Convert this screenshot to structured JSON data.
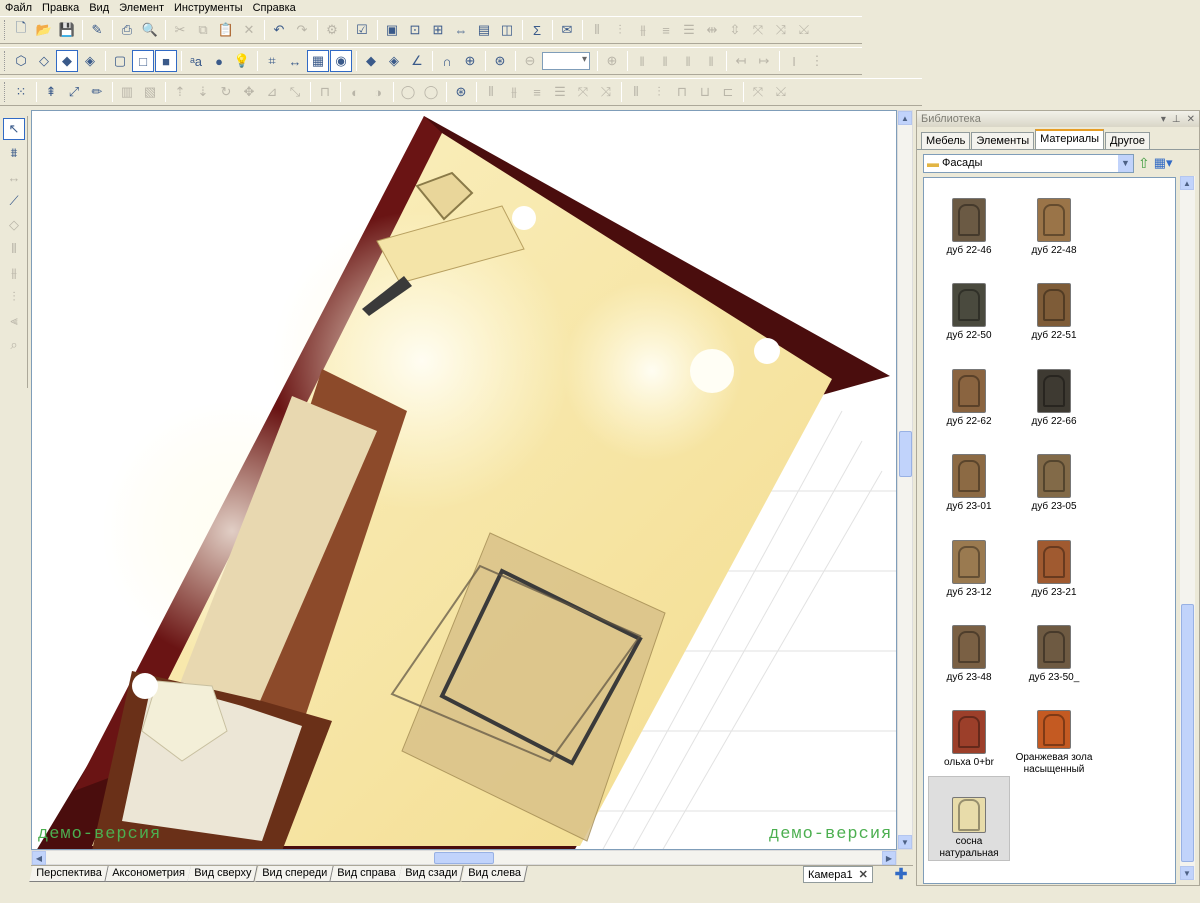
{
  "menu": [
    "Файл",
    "Правка",
    "Вид",
    "Элемент",
    "Инструменты",
    "Справка"
  ],
  "toolbar1": {
    "groups": [
      [
        "new-file-icon",
        "open-file-icon",
        "save-icon"
      ],
      [
        "edit-properties-icon"
      ],
      [
        "print-icon",
        "print-preview-icon"
      ],
      [
        "cut-icon",
        "copy-icon",
        "paste-icon",
        "delete-icon"
      ],
      [
        "undo-icon",
        "redo-icon"
      ],
      [
        "settings-icon"
      ],
      [
        "checklist-icon"
      ],
      [
        "view-frame-icon",
        "zoom-frame-icon",
        "properties-frame-icon",
        "resize-frame-icon",
        "photo-frame-icon",
        "camera-frame-icon"
      ],
      [
        "sum-icon"
      ],
      [
        "mail-icon"
      ],
      [
        "align-left-icon",
        "align-center-icon",
        "align-right-icon",
        "distribute-icon",
        "distribute-v-icon",
        "space-icon",
        "space-v-icon",
        "snap-icon",
        "snap-b-icon",
        "snap-c-icon"
      ]
    ],
    "glyphs": {
      "new-file-icon": "🗋",
      "open-file-icon": "📂",
      "save-icon": "💾",
      "edit-properties-icon": "✎",
      "print-icon": "⎙",
      "print-preview-icon": "🔍",
      "cut-icon": "✂",
      "copy-icon": "⧉",
      "paste-icon": "📋",
      "delete-icon": "✕",
      "undo-icon": "↶",
      "redo-icon": "↷",
      "settings-icon": "⚙",
      "checklist-icon": "☑",
      "view-frame-icon": "▣",
      "zoom-frame-icon": "⊡",
      "properties-frame-icon": "⊞",
      "resize-frame-icon": "⇔",
      "photo-frame-icon": "▤",
      "camera-frame-icon": "◫",
      "sum-icon": "Σ",
      "mail-icon": "✉",
      "align-left-icon": "⫴",
      "align-center-icon": "⫶",
      "align-right-icon": "⫵",
      "distribute-icon": "≡",
      "distribute-v-icon": "☰",
      "space-icon": "⇹",
      "space-v-icon": "⇳",
      "snap-icon": "⤧",
      "snap-b-icon": "⤨",
      "snap-c-icon": "⤩"
    },
    "disabled": [
      "cut-icon",
      "copy-icon",
      "paste-icon",
      "delete-icon",
      "redo-icon",
      "settings-icon",
      "align-left-icon",
      "align-center-icon",
      "align-right-icon",
      "distribute-icon",
      "distribute-v-icon",
      "space-icon",
      "space-v-icon",
      "snap-icon",
      "snap-b-icon",
      "snap-c-icon"
    ]
  },
  "toolbar2": {
    "groups": [
      [
        "box-wire-icon",
        "box-hidden-icon",
        "box-shaded-icon",
        "box-dark-icon"
      ],
      [
        "cube-wire-icon",
        "cube-outline-icon",
        "cube-solid-icon"
      ],
      [
        "text-style-icon",
        "material-icon",
        "light-icon"
      ],
      [
        "measure-icon",
        "dimension-icon",
        "grid-icon",
        "eye-icon"
      ],
      [
        "point-snap-icon",
        "node-snap-icon",
        "angle-snap-icon"
      ],
      [
        "magnet-icon",
        "target-icon"
      ],
      [
        "lifebuoy-icon"
      ],
      [
        "zoom-out-icon"
      ],
      [
        "zoom-in-icon"
      ],
      [
        "hd-a-icon",
        "hd-b-icon",
        "hd-c-icon",
        "hd-d-icon"
      ],
      [
        "ruler-h-icon",
        "ruler-h2-icon"
      ],
      [
        "ruler-v-icon",
        "ruler-v2-icon"
      ]
    ],
    "glyphs": {
      "box-wire-icon": "⬡",
      "box-hidden-icon": "◇",
      "box-shaded-icon": "◆",
      "box-dark-icon": "◈",
      "cube-wire-icon": "▢",
      "cube-outline-icon": "□",
      "cube-solid-icon": "■",
      "text-style-icon": "ᵃa",
      "material-icon": "●",
      "light-icon": "💡",
      "measure-icon": "⌗",
      "dimension-icon": "↔",
      "grid-icon": "▦",
      "eye-icon": "◉",
      "point-snap-icon": "◆",
      "node-snap-icon": "◈",
      "angle-snap-icon": "∠",
      "magnet-icon": "∩",
      "target-icon": "⊕",
      "lifebuoy-icon": "⊛",
      "zoom-out-icon": "⊖",
      "zoom-in-icon": "⊕",
      "hd-a-icon": "‖",
      "hd-b-icon": "‖",
      "hd-c-icon": "‖",
      "hd-d-icon": "‖",
      "ruler-h-icon": "↤",
      "ruler-h2-icon": "↦",
      "ruler-v-icon": "I",
      "ruler-v2-icon": "⋮"
    },
    "pressed": [
      "box-shaded-icon",
      "cube-outline-icon",
      "cube-solid-icon",
      "grid-icon",
      "eye-icon"
    ],
    "disabled": [
      "zoom-out-icon",
      "zoom-in-icon",
      "hd-a-icon",
      "hd-b-icon",
      "hd-c-icon",
      "hd-d-icon",
      "ruler-h-icon",
      "ruler-h2-icon",
      "ruler-v-icon",
      "ruler-v2-icon"
    ],
    "zoom_value": ""
  },
  "toolbar3": {
    "groups": [
      [
        "select-grid-icon"
      ],
      [
        "move-up-icon",
        "pointer-move-icon",
        "pencil-icon"
      ],
      [
        "t3a-icon",
        "t3b-icon"
      ],
      [
        "t3c-icon",
        "t3d-icon",
        "t3e-icon",
        "t3f-icon",
        "t3g-icon",
        "t3h-icon"
      ],
      [
        "t3i-icon"
      ],
      [
        "t3j-icon",
        "t3k-icon"
      ],
      [
        "t3l-icon",
        "t3m-icon"
      ],
      [
        "stop-icon"
      ],
      [
        "t3n-icon",
        "t3o-icon",
        "t3p-icon",
        "t3q-icon",
        "t3r-icon",
        "t3s-icon"
      ],
      [
        "t3t-icon",
        "t3u-icon",
        "t3v-icon",
        "t3w-icon",
        "t3x-icon"
      ],
      [
        "t3y-icon",
        "t3z-icon"
      ]
    ],
    "glyphs": {
      "select-grid-icon": "⁙",
      "move-up-icon": "⇞",
      "pointer-move-icon": "⤢",
      "pencil-icon": "✏",
      "t3a-icon": "▥",
      "t3b-icon": "▧",
      "t3c-icon": "⇡",
      "t3d-icon": "⇣",
      "t3e-icon": "↻",
      "t3f-icon": "✥",
      "t3g-icon": "⊿",
      "t3h-icon": "⤡",
      "t3i-icon": "⊓",
      "t3j-icon": "◐",
      "t3k-icon": "◑",
      "t3l-icon": "◯",
      "t3m-icon": "◯",
      "stop-icon": "⊛",
      "t3n-icon": "⫴",
      "t3o-icon": "⫵",
      "t3p-icon": "≡",
      "t3q-icon": "☰",
      "t3r-icon": "⤧",
      "t3s-icon": "⤨",
      "t3t-icon": "⫴",
      "t3u-icon": "⫶",
      "t3v-icon": "⊓",
      "t3w-icon": "⊔",
      "t3x-icon": "⊏",
      "t3y-icon": "⤧",
      "t3z-icon": "⤩"
    },
    "enabled": [
      "select-grid-icon",
      "move-up-icon",
      "pointer-move-icon",
      "pencil-icon",
      "stop-icon"
    ]
  },
  "left_tools": [
    {
      "name": "select-arrow-icon",
      "glyph": "↖",
      "pressed": true,
      "enabled": true
    },
    {
      "name": "wall-tool-icon",
      "glyph": "⩩",
      "enabled": true
    },
    {
      "name": "dimension-tool-icon",
      "glyph": "↔",
      "enabled": false
    },
    {
      "name": "eyedropper-icon",
      "glyph": "⟋",
      "enabled": true
    },
    {
      "name": "erase-tool-icon",
      "glyph": "◇",
      "enabled": false
    },
    {
      "name": "align-tool-a-icon",
      "glyph": "⫴",
      "enabled": false
    },
    {
      "name": "align-tool-b-icon",
      "glyph": "⫵",
      "enabled": false
    },
    {
      "name": "align-tool-c-icon",
      "glyph": "⫶",
      "enabled": false
    },
    {
      "name": "align-tool-d-icon",
      "glyph": "⫷",
      "enabled": false
    },
    {
      "name": "zoom-tool-icon",
      "glyph": "⌕",
      "enabled": false
    }
  ],
  "viewport": {
    "watermark_left": "демо-версия",
    "watermark_right": "демо-версия"
  },
  "view_tabs": [
    "Перспектива",
    "Аксонометрия",
    "Вид сверху",
    "Вид спереди",
    "Вид справа",
    "Вид сзади",
    "Вид слева"
  ],
  "camera_tab": "Камера1",
  "library": {
    "title": "Библиотека",
    "tabs": [
      "Мебель",
      "Элементы",
      "Материалы",
      "Другое"
    ],
    "active_tab": 2,
    "folder": "Фасады",
    "items": [
      {
        "label": "дуб 22-46",
        "color": "#6b5a44"
      },
      {
        "label": "дуб 22-48",
        "color": "#9a7448"
      },
      {
        "label": "дуб 22-50",
        "color": "#4a4a3e"
      },
      {
        "label": "дуб 22-51",
        "color": "#7e5c38"
      },
      {
        "label": "дуб 22-62",
        "color": "#8a6440"
      },
      {
        "label": "дуб 22-66",
        "color": "#3e3a32"
      },
      {
        "label": "дуб 23-01",
        "color": "#8c6a44"
      },
      {
        "label": "дуб 23-05",
        "color": "#826a48"
      },
      {
        "label": "дуб 23-12",
        "color": "#9a7a50"
      },
      {
        "label": "дуб 23-21",
        "color": "#a05a30"
      },
      {
        "label": "дуб 23-48",
        "color": "#7a6044"
      },
      {
        "label": "дуб 23-50_",
        "color": "#6e5a42"
      },
      {
        "label": "ольха 0+br",
        "color": "#9c3f2a"
      },
      {
        "label": "Оранжевая зола насыщенный",
        "color": "#c45a22"
      },
      {
        "label": "сосна натуральная",
        "color": "#e8dcaa"
      }
    ]
  }
}
